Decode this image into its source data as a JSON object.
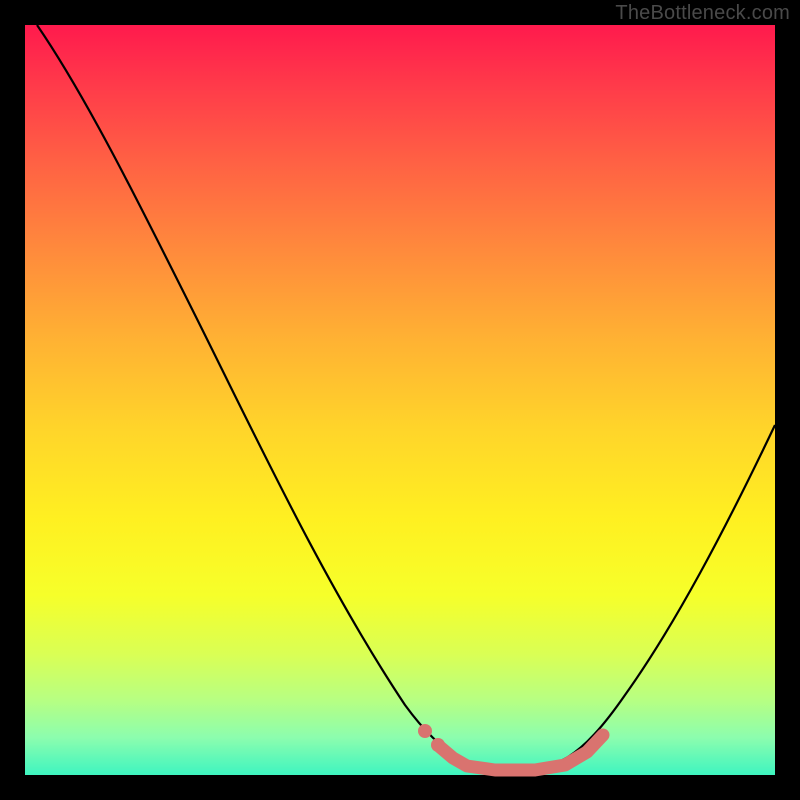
{
  "attribution": "TheBottleneck.com",
  "chart_data": {
    "type": "line",
    "title": "",
    "xlabel": "",
    "ylabel": "",
    "xlim": [
      0,
      100
    ],
    "ylim": [
      0,
      100
    ],
    "background_gradient": {
      "top": "#ff1a4d",
      "middle": "#fff021",
      "bottom": "#3ef5c0"
    },
    "series": [
      {
        "name": "bottleneck-curve",
        "color": "#000000",
        "x": [
          0,
          6,
          12,
          18,
          24,
          30,
          36,
          42,
          48,
          52,
          56,
          60,
          64,
          68,
          72,
          76,
          80,
          84,
          88,
          92,
          96,
          100
        ],
        "values": [
          100,
          95,
          89,
          81,
          71,
          60,
          48,
          36,
          24,
          16,
          9,
          4,
          1,
          0,
          0,
          1,
          4,
          10,
          18,
          28,
          39,
          50
        ]
      },
      {
        "name": "low-bottleneck-highlight",
        "color": "#d9736f",
        "x": [
          52,
          56,
          60,
          64,
          68,
          72,
          76
        ],
        "values": [
          4.5,
          2.5,
          1.2,
          0.7,
          0.7,
          1.3,
          3.5
        ]
      }
    ],
    "highlight_dots": {
      "color": "#d9736f",
      "points": [
        {
          "x": 52,
          "y": 4.5
        },
        {
          "x": 55,
          "y": 2.8
        },
        {
          "x": 76,
          "y": 3.5
        }
      ]
    }
  }
}
